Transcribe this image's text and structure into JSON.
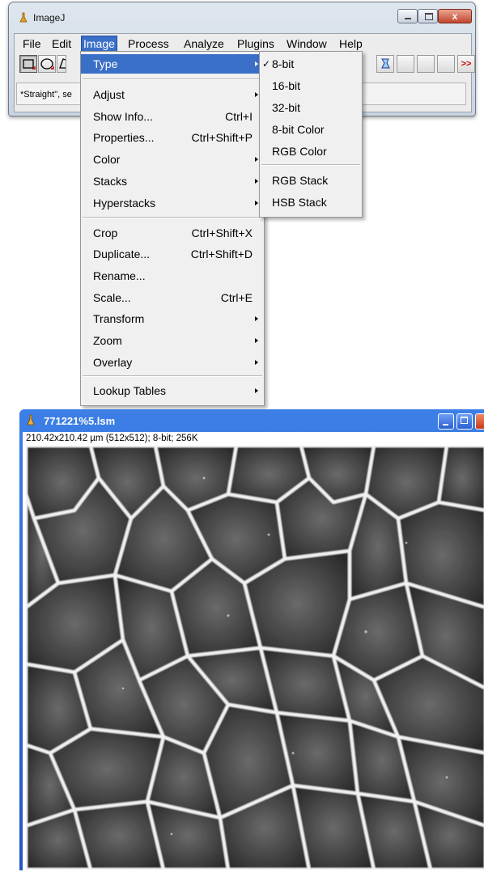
{
  "main_window": {
    "title": "ImageJ",
    "menus": [
      "File",
      "Edit",
      "Image",
      "Process",
      "Analyze",
      "Plugins",
      "Window",
      "Help"
    ],
    "active_menu": "Image",
    "close_glyph": "x",
    "status_text": "*Straight\", se",
    "toolbar_more_glyph": ">>"
  },
  "image_menu": {
    "items": [
      {
        "label": "Type",
        "submenu": true,
        "highlighted": true
      },
      {
        "label": "Adjust",
        "submenu": true
      },
      {
        "label": "Show Info...",
        "shortcut": "Ctrl+I"
      },
      {
        "label": "Properties...",
        "shortcut": "Ctrl+Shift+P"
      },
      {
        "label": "Color",
        "submenu": true
      },
      {
        "label": "Stacks",
        "submenu": true
      },
      {
        "label": "Hyperstacks",
        "submenu": true
      },
      {
        "label": "Crop",
        "shortcut": "Ctrl+Shift+X"
      },
      {
        "label": "Duplicate...",
        "shortcut": "Ctrl+Shift+D"
      },
      {
        "label": "Rename..."
      },
      {
        "label": "Scale...",
        "shortcut": "Ctrl+E"
      },
      {
        "label": "Transform",
        "submenu": true
      },
      {
        "label": "Zoom",
        "submenu": true
      },
      {
        "label": "Overlay",
        "submenu": true
      },
      {
        "label": "Lookup Tables",
        "submenu": true
      }
    ]
  },
  "type_menu": {
    "items": [
      {
        "label": "8-bit",
        "checked": true
      },
      {
        "label": "16-bit"
      },
      {
        "label": "32-bit"
      },
      {
        "label": "8-bit Color"
      },
      {
        "label": "RGB Color"
      },
      {
        "label": "RGB Stack"
      },
      {
        "label": "HSB Stack"
      }
    ],
    "check_glyph": "✓"
  },
  "image_window": {
    "title": "771221%5.lsm",
    "info": "210.42x210.42 µm (512x512); 8-bit; 256K"
  },
  "colors": {
    "menu_highlight": "#3a6fc7",
    "xp_title": "#2a5fd0",
    "close_red": "#c2452d"
  }
}
